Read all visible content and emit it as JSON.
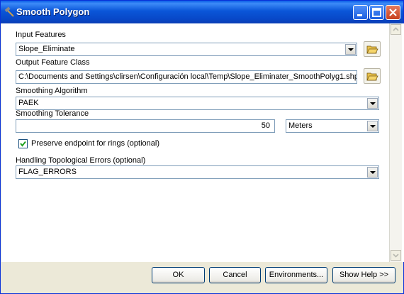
{
  "window": {
    "title": "Smooth Polygon",
    "icon": "hammer-tool-icon"
  },
  "form": {
    "input_features": {
      "label": "Input Features",
      "value": "Slope_Eliminate"
    },
    "output_feature_class": {
      "label": "Output Feature Class",
      "value": "C:\\Documents and Settings\\clirsen\\Configuración local\\Temp\\Slope_Eliminater_SmoothPolyg1.shp"
    },
    "smoothing_algorithm": {
      "label": "Smoothing Algorithm",
      "value": "PAEK"
    },
    "smoothing_tolerance": {
      "label": "Smoothing Tolerance",
      "value": "50",
      "unit": "Meters"
    },
    "preserve_endpoint": {
      "label": "Preserve endpoint for rings (optional)",
      "checked": true
    },
    "topological_errors": {
      "label": "Handling Topological Errors (optional)",
      "value": "FLAG_ERRORS"
    }
  },
  "buttons": {
    "ok": "OK",
    "cancel": "Cancel",
    "environments": "Environments...",
    "show_help": "Show Help >>"
  }
}
